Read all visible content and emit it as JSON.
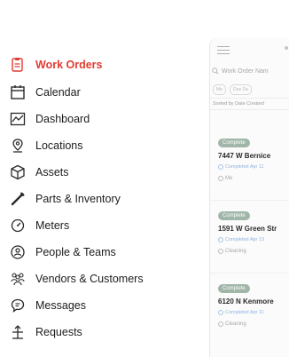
{
  "menu": {
    "items": [
      {
        "label": "Work Orders",
        "icon": "work-orders-icon",
        "active": true
      },
      {
        "label": "Calendar",
        "icon": "calendar-icon",
        "active": false
      },
      {
        "label": "Dashboard",
        "icon": "dashboard-icon",
        "active": false
      },
      {
        "label": "Locations",
        "icon": "location-pin-icon",
        "active": false
      },
      {
        "label": "Assets",
        "icon": "assets-icon",
        "active": false
      },
      {
        "label": "Parts & Inventory",
        "icon": "parts-icon",
        "active": false
      },
      {
        "label": "Meters",
        "icon": "meter-icon",
        "active": false
      },
      {
        "label": "People & Teams",
        "icon": "people-icon",
        "active": false
      },
      {
        "label": "Vendors & Customers",
        "icon": "vendors-icon",
        "active": false
      },
      {
        "label": "Messages",
        "icon": "messages-icon",
        "active": false
      },
      {
        "label": "Requests",
        "icon": "requests-icon",
        "active": false
      }
    ],
    "active_color": "#e03c31"
  },
  "preview": {
    "search_placeholder": "Work Order Nam",
    "filters": [
      "Me",
      "Due Da"
    ],
    "sort_label": "Sorted by Date Created",
    "cards": [
      {
        "status": "Complete",
        "address": "7447 W Bernice",
        "completed": "Completed Apr 11",
        "meta": "Me"
      },
      {
        "status": "Complete",
        "address": "1591 W Green Str",
        "completed": "Completed Apr 13",
        "meta": "Cleaning"
      },
      {
        "status": "Complete",
        "address": "6120 N Kenmore",
        "completed": "Completed Apr 11",
        "meta": "Cleaning"
      }
    ]
  }
}
